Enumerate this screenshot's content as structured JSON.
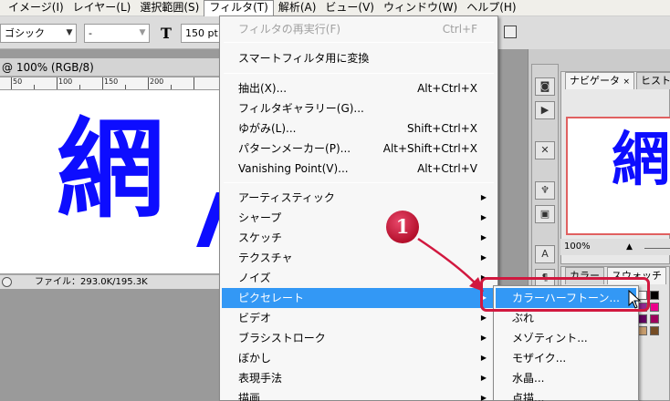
{
  "menubar": {
    "items": [
      {
        "label": "イメージ(I)"
      },
      {
        "label": "レイヤー(L)"
      },
      {
        "label": "選択範囲(S)"
      },
      {
        "label": "フィルタ(T)",
        "open": true
      },
      {
        "label": "解析(A)"
      },
      {
        "label": "ビュー(V)"
      },
      {
        "label": "ウィンドウ(W)"
      },
      {
        "label": "ヘルプ(H)"
      }
    ]
  },
  "options": {
    "font_family": "ゴシック",
    "font_style": "-",
    "font_size_icon": "T",
    "font_size": "150 pt"
  },
  "document": {
    "title": "@ 100% (RGB/8)",
    "ruler_label": "50",
    "ruler_ticks": [
      {
        "label": "50"
      },
      {
        "label": "100"
      },
      {
        "label": "150"
      },
      {
        "label": "200"
      }
    ],
    "canvas_text": "網",
    "status": "ファイル：293.0K/195.3K"
  },
  "filter_menu": {
    "items": [
      {
        "label": "フィルタの再実行(F)",
        "shortcut": "Ctrl+F",
        "disabled": true
      },
      {
        "label": "スマートフィルタ用に変換"
      },
      {
        "label": "抽出(X)...",
        "shortcut": "Alt+Ctrl+X"
      },
      {
        "label": "フィルタギャラリー(G)..."
      },
      {
        "label": "ゆがみ(L)...",
        "shortcut": "Shift+Ctrl+X"
      },
      {
        "label": "パターンメーカー(P)...",
        "shortcut": "Alt+Shift+Ctrl+X"
      },
      {
        "label": "Vanishing Point(V)...",
        "shortcut": "Alt+Ctrl+V"
      },
      {
        "label": "アーティスティック",
        "submenu": true
      },
      {
        "label": "シャープ",
        "submenu": true
      },
      {
        "label": "スケッチ",
        "submenu": true
      },
      {
        "label": "テクスチャ",
        "submenu": true
      },
      {
        "label": "ノイズ",
        "submenu": true
      },
      {
        "label": "ピクセレート",
        "submenu": true,
        "highlighted": true
      },
      {
        "label": "ビデオ",
        "submenu": true
      },
      {
        "label": "ブラシストローク",
        "submenu": true
      },
      {
        "label": "ぼかし",
        "submenu": true
      },
      {
        "label": "表現手法",
        "submenu": true
      },
      {
        "label": "描画",
        "submenu": true
      }
    ],
    "submenu_arrow": "▶"
  },
  "pixelate_menu": {
    "items": [
      {
        "label": "カラーハーフトーン...",
        "highlighted": true
      },
      {
        "label": "ぶれ"
      },
      {
        "label": "メゾティント..."
      },
      {
        "label": "モザイク..."
      },
      {
        "label": "水晶..."
      },
      {
        "label": "点描..."
      }
    ]
  },
  "panels": {
    "navigator_tab": "ナビゲータ",
    "histogram_tab": "ヒスト",
    "close_glyph": "×",
    "nav_thumb_text": "網",
    "zoom": "100%",
    "color_tab": "カラー",
    "swatches_tab": "スウォッチ"
  },
  "annotation": {
    "step": "1"
  },
  "colors": {
    "accent": "#3398f5",
    "callout": "#d1183f",
    "text_blue": "#0d0dff"
  }
}
